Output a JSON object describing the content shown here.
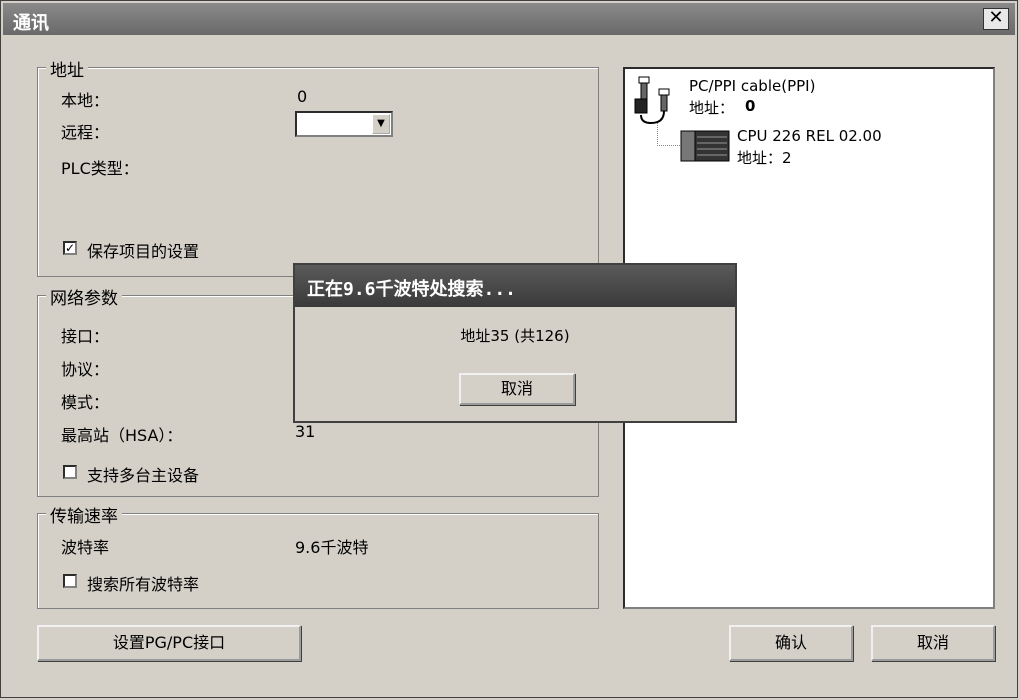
{
  "window": {
    "title": "通讯"
  },
  "address": {
    "legend": "地址",
    "local_label": "本地：",
    "local_value": "0",
    "remote_label": "远程：",
    "remote_value": "",
    "plc_type_label": "PLC类型：",
    "save_settings_label": "保存项目的设置",
    "save_settings_checked": true
  },
  "network": {
    "legend": "网络参数",
    "interface_label": "接口：",
    "protocol_label": "协议：",
    "mode_label": "模式：",
    "hsa_label": "最高站（HSA）：",
    "hsa_value": "31",
    "multimaster_label": "支持多台主设备",
    "multimaster_checked": false
  },
  "transfer": {
    "legend": "传输速率",
    "baud_label": "波特率",
    "baud_value": "9.6千波特",
    "search_all_label": "搜索所有波特率",
    "search_all_checked": false
  },
  "tree": {
    "cable_name": "PC/PPI cable(PPI)",
    "cable_addr_label": "地址：",
    "cable_addr": "0",
    "cpu_name": "CPU 226 REL 02.00",
    "cpu_addr": "地址：2"
  },
  "buttons": {
    "set_pgpc": "设置PG/PC接口",
    "ok": "确认",
    "cancel": "取消"
  },
  "search_dialog": {
    "title": "正在9.6千波特处搜索...",
    "status": "地址35 (共126)",
    "cancel": "取消"
  }
}
